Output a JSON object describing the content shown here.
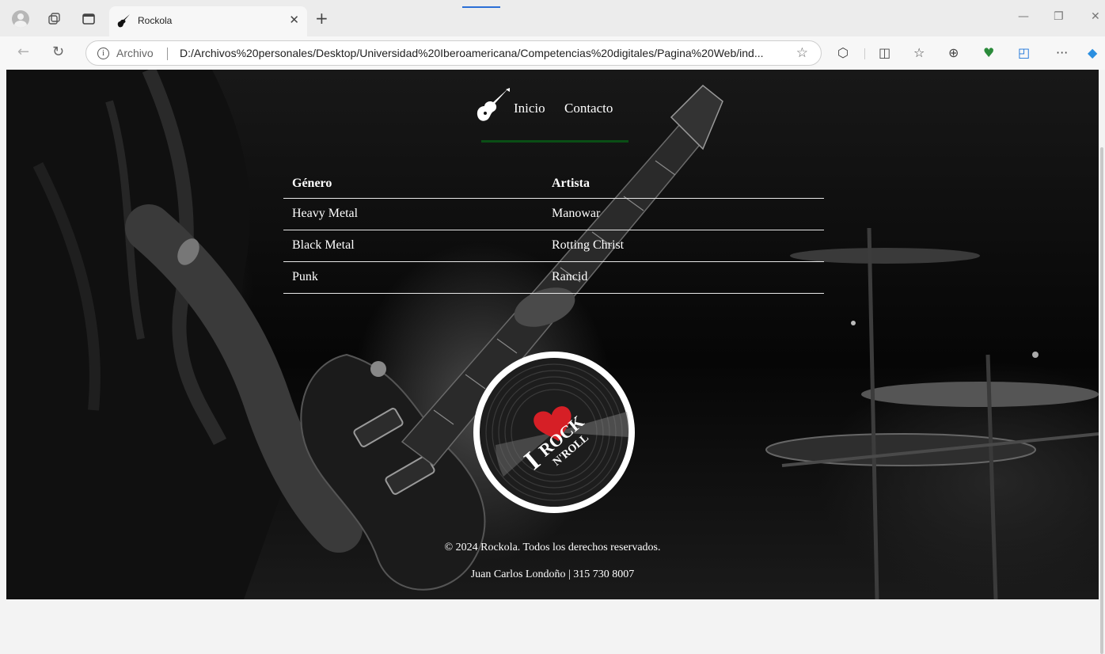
{
  "browser": {
    "tab_title": "Rockola",
    "address_origin": "Archivo",
    "address_url": "D:/Archivos%20personales/Desktop/Universidad%20Iberoamericana/Competencias%20digitales/Pagina%20Web/ind...",
    "accent": "#2b6fd6",
    "icons": [
      "profile-icon",
      "workspaces-icon",
      "tab-actions-icon",
      "close-tab-icon",
      "new-tab-icon",
      "back-icon",
      "reload-icon",
      "info-icon",
      "favorite-star-icon",
      "extensions-icon",
      "split-screen-icon",
      "favorites-icon",
      "collections-icon",
      "browser-essentials-icon",
      "edge-icon",
      "more-icon",
      "copilot-icon",
      "minimize-icon",
      "restore-icon",
      "close-window-icon"
    ]
  },
  "site": {
    "nav": {
      "home": "Inicio",
      "contact": "Contacto"
    },
    "nav_underline_color": "#0a4e15",
    "table": {
      "headers": [
        "Género",
        "Artista"
      ],
      "rows": [
        [
          "Heavy Metal",
          "Manowar"
        ],
        [
          "Black Metal",
          "Rotting Christ"
        ],
        [
          "Punk",
          "Rancid"
        ]
      ]
    },
    "record_logo": {
      "letter": "I",
      "line1": "ROCK",
      "line2": "N'ROLL",
      "heart_color": "#d61f26"
    },
    "footer": {
      "copyright": "© 2024 Rockola. Todos los derechos reservados.",
      "contact": "Juan Carlos Londoño | 315 730 8007"
    }
  }
}
